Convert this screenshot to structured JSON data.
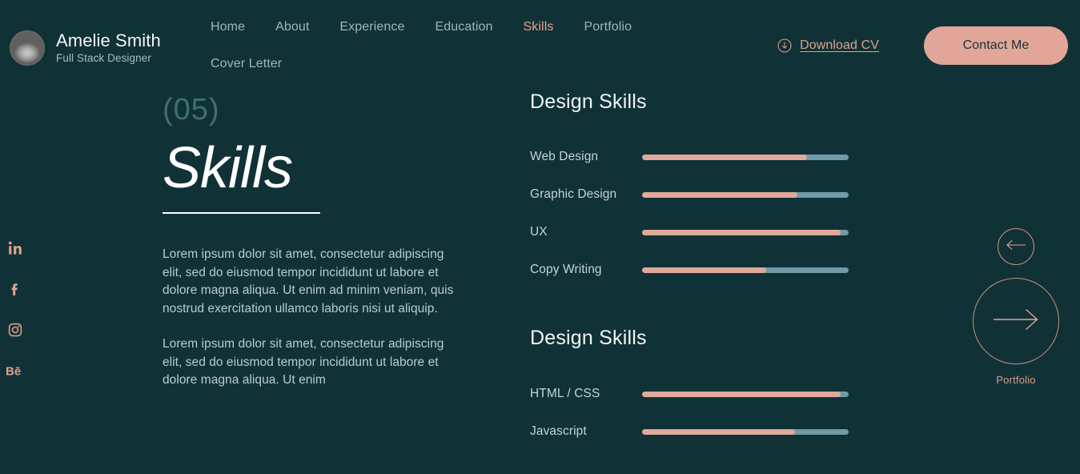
{
  "brand": {
    "name": "Amelie Smith",
    "role": "Full Stack Designer"
  },
  "nav": {
    "items": [
      {
        "label": "Home",
        "active": false
      },
      {
        "label": "About",
        "active": false
      },
      {
        "label": "Experience",
        "active": false
      },
      {
        "label": "Education",
        "active": false
      },
      {
        "label": "Skills",
        "active": true
      },
      {
        "label": "Portfolio",
        "active": false
      },
      {
        "label": "Cover Letter",
        "active": false
      }
    ]
  },
  "header_actions": {
    "download_label": "Download CV",
    "contact_label": "Contact Me"
  },
  "social": {
    "items": [
      {
        "name": "linkedin",
        "glyph": "in"
      },
      {
        "name": "facebook",
        "glyph": "f"
      },
      {
        "name": "instagram",
        "glyph": ""
      },
      {
        "name": "behance",
        "glyph": "Bē"
      }
    ]
  },
  "section": {
    "number": "(05)",
    "title": "Skills",
    "paragraph_1": "Lorem ipsum dolor sit amet, consectetur adipiscing elit, sed do eiusmod tempor incididunt ut labore et dolore magna aliqua. Ut enim ad minim veniam, quis nostrud exercitation ullamco laboris nisi ut aliquip.",
    "paragraph_2": "Lorem ipsum dolor sit amet, consectetur adipiscing elit, sed do eiusmod tempor incididunt ut labore et dolore magna aliqua. Ut enim"
  },
  "pager": {
    "label": "Portfolio"
  },
  "colors": {
    "background": "#103237",
    "accent": "#e2a698",
    "bar_fill": "#e0a99b",
    "bar_track": "#6f9ba5",
    "text_primary": "#f0f4f3",
    "text_muted": "#b9cccd",
    "nav_inactive": "#9fb6b8",
    "section_number": "#3f6f73"
  },
  "chart_data": [
    {
      "type": "bar",
      "title": "Design Skills",
      "orientation": "horizontal",
      "categories": [
        "Web Design",
        "Graphic Design",
        "UX",
        "Copy Writing"
      ],
      "values": [
        80,
        75,
        96,
        60
      ],
      "xlabel": "",
      "ylabel": "",
      "xlim": [
        0,
        100
      ],
      "grid": false,
      "legend": "none",
      "value_labels_shown": false
    },
    {
      "type": "bar",
      "title": "Design Skills",
      "orientation": "horizontal",
      "categories": [
        "HTML / CSS",
        "Javascript"
      ],
      "values": [
        96,
        74
      ],
      "xlabel": "",
      "ylabel": "",
      "xlim": [
        0,
        100
      ],
      "grid": false,
      "legend": "none",
      "value_labels_shown": false
    }
  ]
}
